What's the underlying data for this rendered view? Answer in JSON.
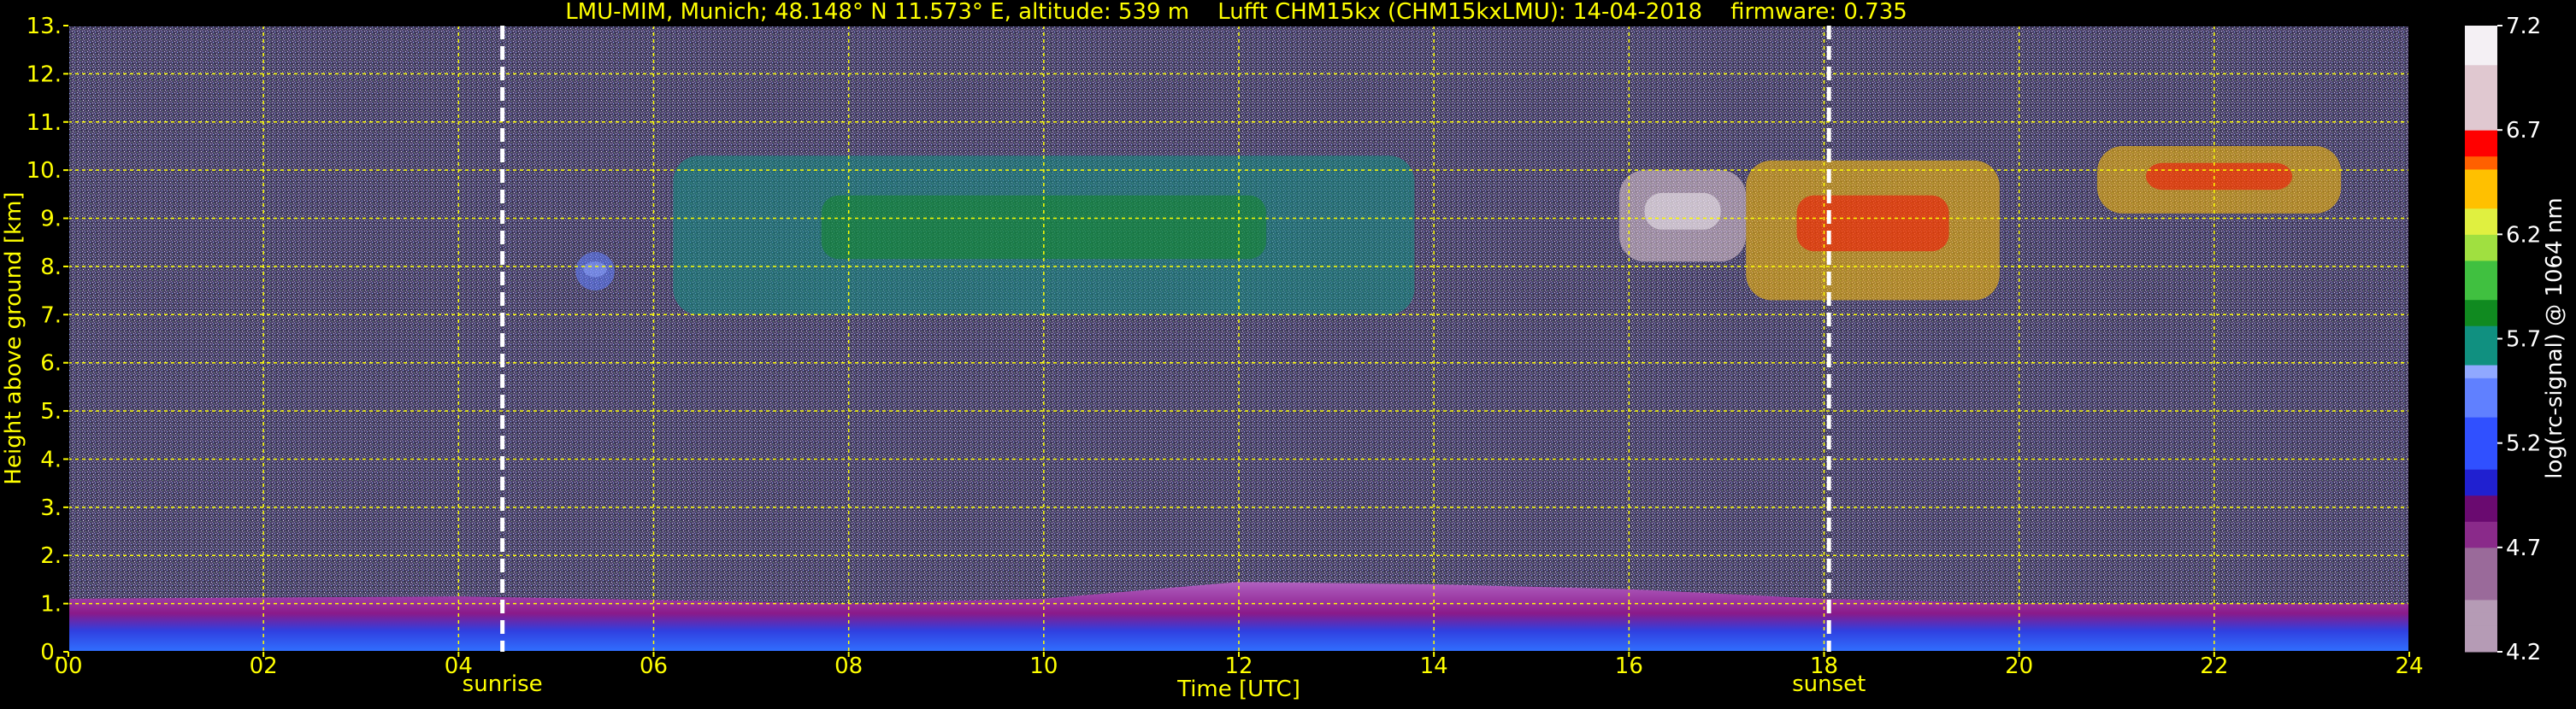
{
  "chart_data": {
    "type": "heatmap",
    "title": "LMU-MIM, Munich; 48.148° N 11.573° E, altitude: 539 m    Lufft CHM15kx (CHM15kxLMU): 14-04-2018    firmware: 0.735",
    "xlabel": "Time [UTC]",
    "ylabel": "Height above ground [km]",
    "colorbar_label": "log(rc-signal) @ 1064 nm",
    "xlim": [
      0,
      24
    ],
    "ylim": [
      0,
      13
    ],
    "x_ticks": [
      "00",
      "02",
      "04",
      "06",
      "08",
      "10",
      "12",
      "14",
      "16",
      "18",
      "20",
      "22",
      "24"
    ],
    "y_ticks": [
      "0.",
      "1.",
      "2.",
      "3.",
      "4.",
      "5.",
      "6.",
      "7.",
      "8.",
      "9.",
      "10.",
      "11.",
      "12.",
      "13."
    ],
    "colorbar_ticks": [
      "4.2",
      "4.7",
      "5.2",
      "5.7",
      "6.2",
      "6.7",
      "7.2"
    ],
    "colorbar_range": [
      4.2,
      7.2
    ],
    "grid": true,
    "markers": [
      {
        "label": "sunrise",
        "x": 4.45
      },
      {
        "label": "sunset",
        "x": 18.05
      }
    ],
    "features": {
      "boundary_layer": [
        {
          "t": 0,
          "top": 1.1
        },
        {
          "t": 4,
          "top": 1.15
        },
        {
          "t": 8,
          "top": 1.0
        },
        {
          "t": 10,
          "top": 1.1
        },
        {
          "t": 12,
          "top": 1.45
        },
        {
          "t": 14,
          "top": 1.4
        },
        {
          "t": 16,
          "top": 1.3
        },
        {
          "t": 18,
          "top": 1.1
        },
        {
          "t": 20,
          "top": 1.0
        },
        {
          "t": 24,
          "top": 1.0
        }
      ],
      "cloud_layers": [
        {
          "t_start": 6.2,
          "t_end": 13.8,
          "base": 7.0,
          "top": 10.3,
          "level": 5.6
        },
        {
          "t_start": 15.9,
          "t_end": 17.2,
          "base": 8.1,
          "top": 10.0,
          "level": 6.8
        },
        {
          "t_start": 17.2,
          "t_end": 19.8,
          "base": 7.3,
          "top": 10.2,
          "level": 6.4
        },
        {
          "t_start": 20.8,
          "t_end": 23.3,
          "base": 9.1,
          "top": 10.5,
          "level": 6.4
        },
        {
          "t_start": 5.2,
          "t_end": 5.6,
          "base": 7.5,
          "top": 8.3,
          "level": 5.3
        }
      ]
    },
    "colors": {
      "background": "#000000",
      "text": "#ffff00",
      "grid": "#ffff00",
      "noise": "#5a4f78",
      "marker": "#ffffff"
    }
  }
}
